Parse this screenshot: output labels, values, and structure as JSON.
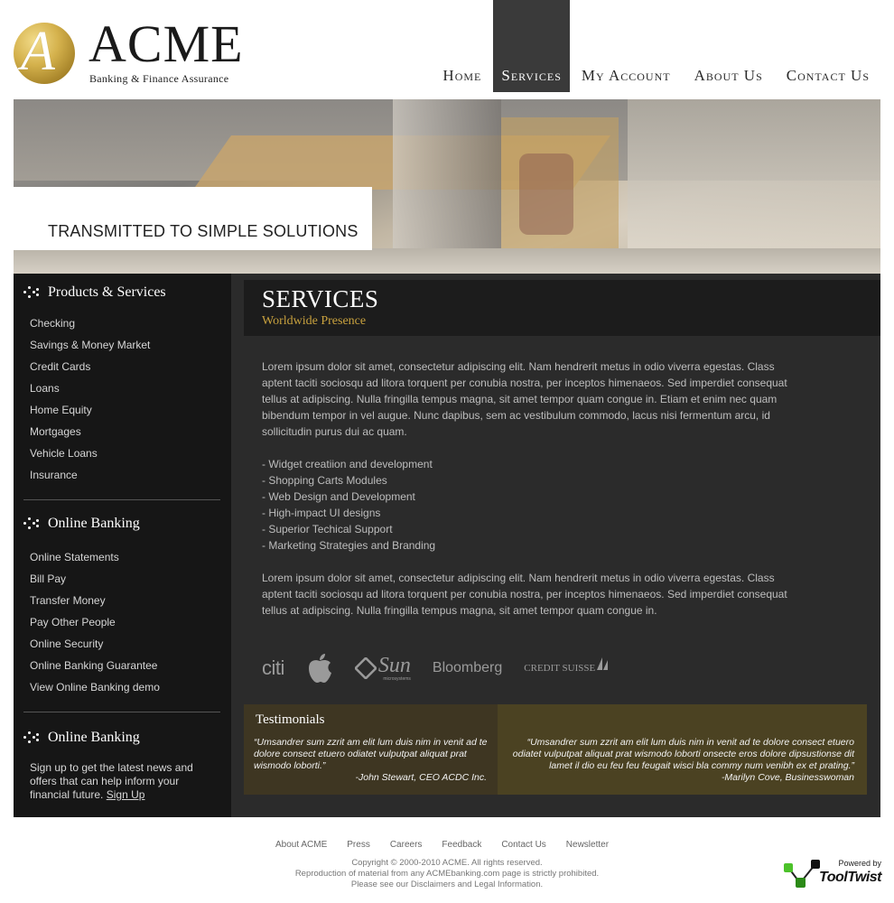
{
  "logo": {
    "mark": "A",
    "name": "ACME",
    "tagline": "Banking & Finance Assurance"
  },
  "nav": [
    {
      "label": "Home",
      "active": false
    },
    {
      "label": "Services",
      "active": true
    },
    {
      "label": "My Account",
      "active": false
    },
    {
      "label": "About Us",
      "active": false
    },
    {
      "label": "Contact Us",
      "active": false
    }
  ],
  "banner": {
    "caption": "TRANSMITTED TO SIMPLE SOLUTIONS"
  },
  "sidebar": {
    "products_heading": "Products & Services",
    "products": [
      "Checking",
      "Savings & Money Market",
      "Credit Cards",
      "Loans",
      "Home Equity",
      "Mortgages",
      "Vehicle Loans",
      "Insurance"
    ],
    "online_heading": "Online Banking",
    "online": [
      "Online Statements",
      "Bill Pay",
      "Transfer Money",
      "Pay Other People",
      "Online Security",
      "Online Banking Guarantee",
      "View Online Banking demo"
    ],
    "signup_heading": "Online Banking",
    "signup_text": "Sign up to get the latest news and offers that can help inform your financial future.",
    "signup_link": "Sign Up"
  },
  "content": {
    "title": "SERVICES",
    "subtitle": "Worldwide Presence",
    "paragraph1": "Lorem ipsum dolor sit amet, consectetur adipiscing elit. Nam hendrerit metus in odio viverra egestas. Class aptent taciti sociosqu ad litora torquent per conubia nostra, per inceptos himenaeos. Sed imperdiet consequat tellus at adipiscing. Nulla fringilla tempus magna, sit amet tempor quam congue in. Etiam et enim nec quam bibendum tempor in vel augue. Nunc dapibus, sem ac vestibulum commodo, lacus nisi fermentum arcu, id sollicitudin purus dui ac quam.",
    "bullets": [
      "- Widget creatiion and development",
      "- Shopping Carts Modules",
      "- Web Design and Development",
      "- High-impact UI designs",
      "- Superior Techical Support",
      "- Marketing Strategies and Branding"
    ],
    "paragraph2": "Lorem ipsum dolor sit amet, consectetur adipiscing elit. Nam hendrerit metus in odio viverra egestas. Class aptent taciti sociosqu ad litora torquent per conubia nostra, per inceptos himenaeos. Sed imperdiet consequat tellus at adipiscing. Nulla fringilla tempus magna, sit amet tempor quam congue in."
  },
  "partners": [
    "citi",
    "apple",
    "Sun",
    "microsystems",
    "Bloomberg",
    "CREDIT SUISSE"
  ],
  "testimonials": {
    "title": "Testimonials",
    "left_quote": "“Umsandrer sum zzrit am elit lum duis nim in venit ad te dolore consect etuero odiatet vulputpat aliquat prat wismodo loborti.”",
    "left_author": "-John Stewart, CEO ACDC Inc.",
    "right_quote": "“Umsandrer sum zzrit am elit lum duis nim in venit ad te dolore consect etuero odiatet vulputpat aliquat prat wismodo loborti onsecte eros dolore dipsustionse dit lamet il dio eu feu feu feugait wisci bla commy num venibh ex et prating.”",
    "right_author": "-Marilyn Cove, Businesswoman"
  },
  "footer": {
    "links": [
      "About ACME",
      "Press",
      "Careers",
      "Feedback",
      "Contact Us",
      "Newsletter"
    ],
    "copyright1": "Copyright © 2000-2010 ACME. All rights reserved.",
    "copyright2": "Reproduction of material from any ACMEbanking.com page is strictly prohibited.",
    "copyright3": "Please see our Disclaimers and Legal Information.",
    "powered_by": "Powered by",
    "tooltwist": "ToolTwist"
  },
  "colors": {
    "gold": "#c9a23e",
    "dark": "#2b2b2b",
    "sidebar": "#161616",
    "nav_active": "#3a3a3a"
  }
}
